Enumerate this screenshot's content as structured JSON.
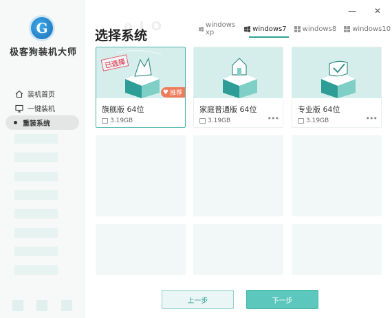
{
  "app": {
    "logo_letter": "G",
    "title": "极客狗装机大师"
  },
  "window": {
    "minimize": "—",
    "close": "✕"
  },
  "sidebar": {
    "items": [
      {
        "label": "装机首页",
        "icon": "home-icon"
      },
      {
        "label": "一键装机",
        "icon": "monitor-icon"
      },
      {
        "label": "重装系统",
        "icon": "dot-icon"
      }
    ]
  },
  "header": {
    "title": "选择系统",
    "ghost": "o I O"
  },
  "tabs": [
    {
      "label": "windows xp",
      "icon": "windows-icon"
    },
    {
      "label": "windows7",
      "icon": "windows-icon"
    },
    {
      "label": "windows8",
      "icon": "windows-icon"
    },
    {
      "label": "windows10",
      "icon": "windows-icon"
    }
  ],
  "cards": [
    {
      "name": "旗舰版 64位",
      "size": "3.19GB",
      "selected_badge": "已选择",
      "recommend_badge": "推荐",
      "icon": "king-crown-box-icon"
    },
    {
      "name": "家庭普通版 64位",
      "size": "3.19GB",
      "icon": "house-box-icon"
    },
    {
      "name": "专业版 64位",
      "size": "3.19GB",
      "icon": "check-badge-box-icon"
    }
  ],
  "more_icon": "•••",
  "buttons": {
    "prev": "上一步",
    "next": "下一步"
  },
  "colors": {
    "accent": "#5cc8bd",
    "accent_dark": "#2ba39a",
    "selected_border": "#48b5ab",
    "recommend": "#f07b5a",
    "selected_stamp": "#e0566a"
  }
}
